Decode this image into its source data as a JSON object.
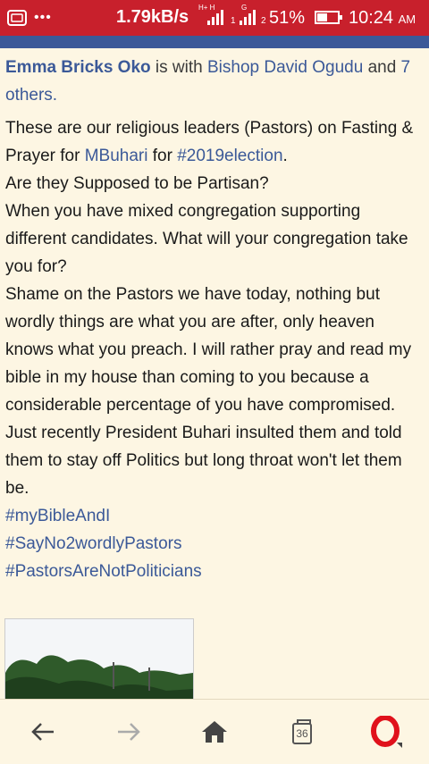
{
  "status_bar": {
    "speed": "1.79kB/s",
    "sim1_label": "1",
    "sim2_label": "2",
    "battery_percent": "51%",
    "battery_level": 0.51,
    "time": "10:24",
    "ampm": "AM",
    "left_icons": [
      "message-icon",
      "more-notifications-icon"
    ]
  },
  "post": {
    "author": "Emma Bricks Oko",
    "with_text": "is with",
    "tagged_person": "Bishop David Ogudu",
    "and_text": "and",
    "others": "7 others.",
    "body": {
      "p1_a": "These are our religious leaders (Pastors) on Fasting & Prayer for ",
      "p1_link1": "MBuhari",
      "p1_b": " for ",
      "p1_link2": "#2019election",
      "p1_c": ".",
      "p2": "Are they Supposed to be Partisan?",
      "p3": "When you have mixed congregation supporting different candidates. What will your congregation take you for?",
      "p4": "Shame on the Pastors we have today, nothing but wordly things are what you are after, only heaven knows what you preach. I will rather pray and read my bible in my house than coming to you because a considerable percentage of you have compromised.",
      "p5": "Just recently President Buhari insulted them and told them to stay off Politics but long throat won't let them be."
    },
    "hashtags": [
      "#myBibleAndI",
      "#SayNo2wordlyPastors",
      "#PastorsAreNotPoliticians"
    ]
  },
  "bottom_bar": {
    "back_icon": "back-arrow-icon",
    "forward_icon": "forward-arrow-icon",
    "home_icon": "home-icon",
    "tabs_count": "36",
    "menu_icon": "opera-logo-icon"
  },
  "colors": {
    "status_bar": "#c8202c",
    "link": "#3b5998",
    "background": "#fdf6e3"
  }
}
